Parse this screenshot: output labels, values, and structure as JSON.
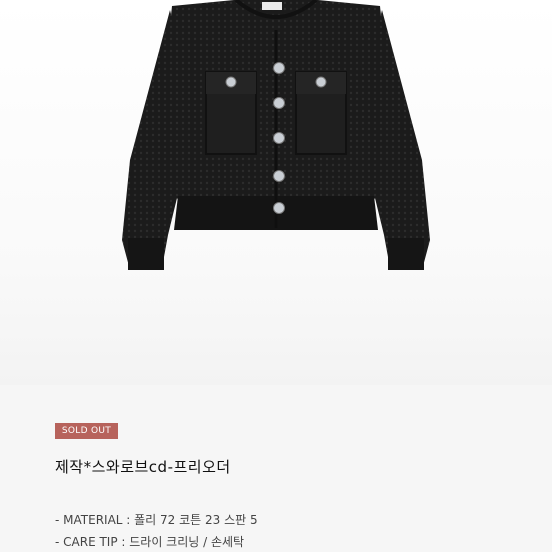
{
  "product": {
    "badge": "SOLD OUT",
    "title": "제작*스와로브cd-프리오더",
    "specs": [
      "- MATERIAL : 폴리 72 코튼 23 스판 5",
      "- CARE TIP : 드라이 크리닝 / 손세탁"
    ],
    "image_subject": "black-knit-cardigan-icon"
  },
  "colors": {
    "badge": "#b7635c",
    "garment": "#1b1b1b",
    "buttons": "#c9ced4"
  }
}
